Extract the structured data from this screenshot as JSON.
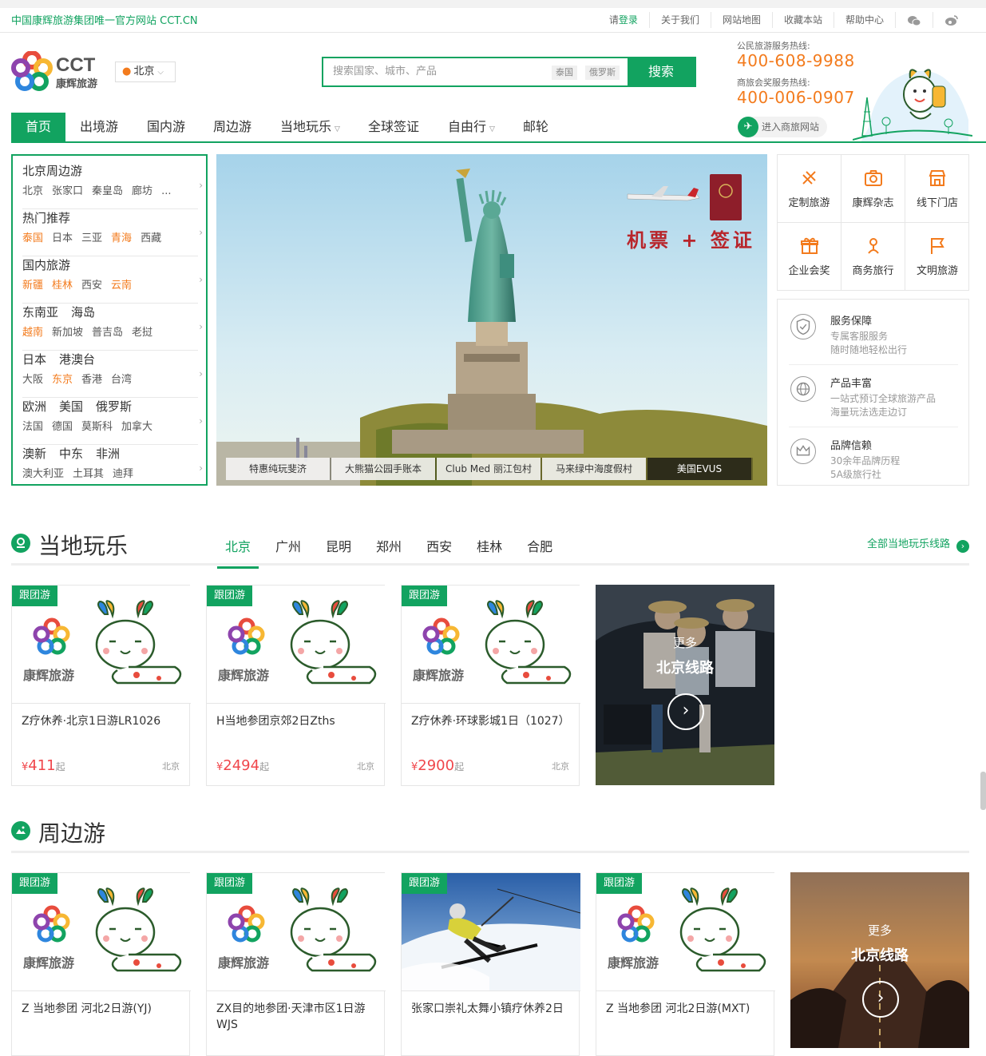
{
  "topbar": {
    "slogan": "中国康辉旅游集团唯一官方网站 CCT.CN",
    "login_prefix": "请",
    "login": "登录",
    "links": [
      "关于我们",
      "网站地图",
      "收藏本站",
      "帮助中心"
    ],
    "icons": [
      "wechat-icon",
      "weibo-icon"
    ]
  },
  "header": {
    "logo_en": "CCT",
    "logo_cn": "康辉旅游",
    "city": "北京",
    "search_placeholder": "搜索国家、城市、产品",
    "search_tags": [
      "泰国",
      "俄罗斯"
    ],
    "search_button": "搜索",
    "hotline1_label": "公民旅游服务热线:",
    "hotline1": "400-608-9988",
    "hotline2_label": "商旅会奖服务热线:",
    "hotline2": "400-006-0907",
    "biz_link": "进入商旅网站"
  },
  "nav": {
    "items": [
      {
        "label": "首页",
        "active": true
      },
      {
        "label": "出境游"
      },
      {
        "label": "国内游"
      },
      {
        "label": "周边游"
      },
      {
        "label": "当地玩乐",
        "dropdown": true
      },
      {
        "label": "全球签证"
      },
      {
        "label": "自由行",
        "dropdown": true
      },
      {
        "label": "邮轮"
      }
    ]
  },
  "categories": [
    {
      "title": [
        "北京周边游"
      ],
      "subs": [
        "北京",
        "张家口",
        "秦皇岛",
        "廊坊",
        "..."
      ],
      "hl": []
    },
    {
      "title": [
        "热门推荐"
      ],
      "subs": [
        "泰国",
        "日本",
        "三亚",
        "青海",
        "西藏"
      ],
      "hl": [
        0,
        3
      ]
    },
    {
      "title": [
        "国内旅游"
      ],
      "subs": [
        "新疆",
        "桂林",
        "西安",
        "云南"
      ],
      "hl": [
        0,
        1,
        3
      ]
    },
    {
      "title": [
        "东南亚",
        "海岛"
      ],
      "subs": [
        "越南",
        "新加坡",
        "普吉岛",
        "老挝"
      ],
      "hl": [
        0
      ]
    },
    {
      "title": [
        "日本",
        "港澳台"
      ],
      "subs": [
        "大阪",
        "东京",
        "香港",
        "台湾"
      ],
      "hl": [
        1
      ]
    },
    {
      "title": [
        "欧洲",
        "美国",
        "俄罗斯"
      ],
      "subs": [
        "法国",
        "德国",
        "莫斯科",
        "加拿大"
      ],
      "hl": []
    },
    {
      "title": [
        "澳新",
        "中东",
        "非洲"
      ],
      "subs": [
        "澳大利亚",
        "土耳其",
        "迪拜"
      ],
      "hl": []
    }
  ],
  "banner": {
    "promo": "机票 + 签证",
    "tabs": [
      "特惠纯玩斐济",
      "大熊猫公园手账本",
      "Club Med 丽江包村",
      "马来绿中海度假村",
      "美国EVUS"
    ],
    "active_tab": 4
  },
  "services": [
    {
      "label": "定制旅游",
      "icon": "custom-tour-icon"
    },
    {
      "label": "康辉杂志",
      "icon": "camera-icon"
    },
    {
      "label": "线下门店",
      "icon": "store-icon"
    },
    {
      "label": "企业会奖",
      "icon": "gift-icon"
    },
    {
      "label": "商务旅行",
      "icon": "location-person-icon"
    },
    {
      "label": "文明旅游",
      "icon": "flag-icon"
    }
  ],
  "guarantees": [
    {
      "title": "服务保障",
      "l1": "专属客服服务",
      "l2": "随时随地轻松出行",
      "icon": "shield-check-icon"
    },
    {
      "title": "产品丰富",
      "l1": "一站式预订全球旅游产品",
      "l2": "海量玩法选走边订",
      "icon": "globe-icon"
    },
    {
      "title": "品牌信赖",
      "l1": "30余年品牌历程",
      "l2": "5A级旅行社",
      "icon": "crown-icon"
    }
  ],
  "local": {
    "title": "当地玩乐",
    "tabs": [
      "北京",
      "广州",
      "昆明",
      "郑州",
      "西安",
      "桂林",
      "合肥"
    ],
    "active_tab": 0,
    "more": "全部当地玩乐线路",
    "cards": [
      {
        "badge": "跟团游",
        "name": "Z疗休养·北京1日游LR1026",
        "currency": "¥",
        "price": "411",
        "suffix": "起",
        "loc": "北京"
      },
      {
        "badge": "跟团游",
        "name": "H当地参团京郊2日Zths",
        "currency": "¥",
        "price": "2494",
        "suffix": "起",
        "loc": "北京"
      },
      {
        "badge": "跟团游",
        "name": "Z疗休养·环球影城1日（1027）",
        "currency": "¥",
        "price": "2900",
        "suffix": "起",
        "loc": "北京"
      }
    ],
    "more_card": {
      "line1": "更多",
      "line2": "北京线路"
    }
  },
  "nearby": {
    "title": "周边游",
    "cards": [
      {
        "badge": "跟团游",
        "name": "Z 当地参团 河北2日游(YJ)"
      },
      {
        "badge": "跟团游",
        "name": "ZX目的地参团·天津市区1日游WJS"
      },
      {
        "badge": "跟团游",
        "name": "张家口崇礼太舞小镇疗休养2日"
      },
      {
        "badge": "跟团游",
        "name": "Z 当地参团 河北2日游(MXT)"
      }
    ],
    "more_card": {
      "line1": "更多",
      "line2": "北京线路"
    }
  },
  "colors": {
    "brand": "#12a360",
    "accent": "#f37b1d",
    "price": "#f0464b"
  }
}
